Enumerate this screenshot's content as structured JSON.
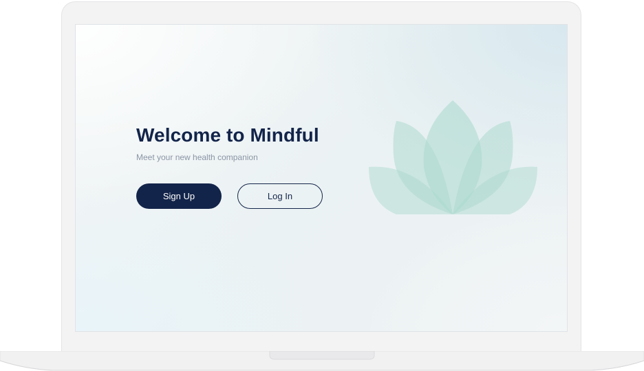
{
  "hero": {
    "title": "Welcome to Mindful",
    "subtitle": "Meet your new health companion"
  },
  "actions": {
    "sign_up_label": "Sign Up",
    "log_in_label": "Log In"
  },
  "colors": {
    "brand_navy": "#13244a",
    "lotus_teal": "#a9d8cc",
    "subtitle_gray": "#8b95a5"
  },
  "icons": {
    "hero_illustration": "lotus-icon"
  }
}
